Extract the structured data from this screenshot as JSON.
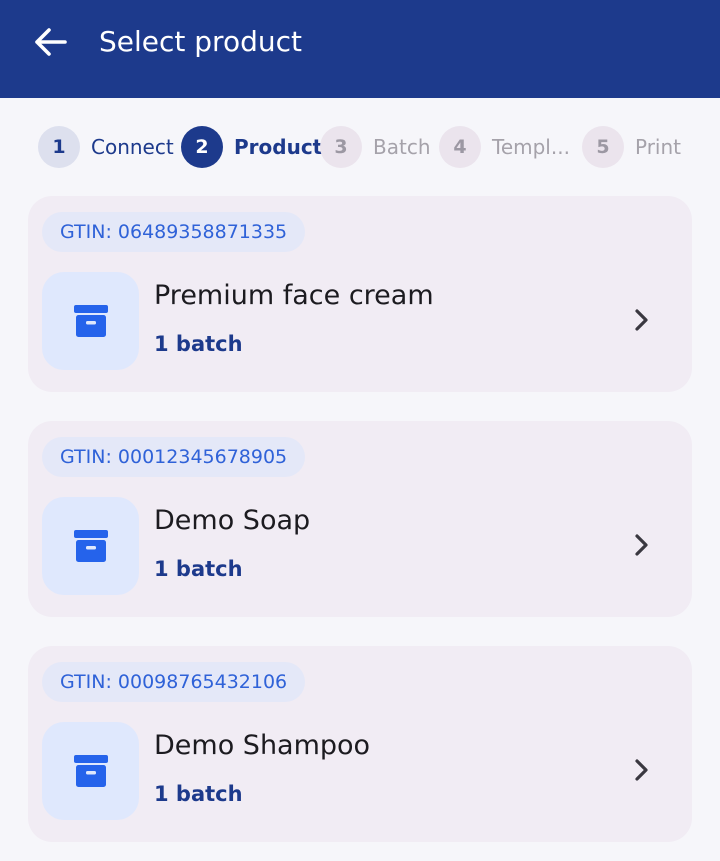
{
  "app_bar": {
    "title": "Select product",
    "back_icon": "arrow-left-icon",
    "background_color": "#1d3a8c"
  },
  "stepper": {
    "steps": [
      {
        "number": "1",
        "label": "Connect",
        "state": "done"
      },
      {
        "number": "2",
        "label": "Product",
        "state": "current"
      },
      {
        "number": "3",
        "label": "Batch",
        "state": "pending"
      },
      {
        "number": "4",
        "label": "Templ...",
        "state": "pending"
      },
      {
        "number": "5",
        "label": "Print",
        "state": "pending"
      }
    ]
  },
  "products": [
    {
      "gtin": "GTIN: 06489358871335",
      "name": "Premium face cream",
      "batches": "1 batch",
      "icon": "archive-box-icon"
    },
    {
      "gtin": "GTIN: 00012345678905",
      "name": "Demo Soap",
      "batches": "1 batch",
      "icon": "archive-box-icon"
    },
    {
      "gtin": "GTIN: 00098765432106",
      "name": "Demo Shampoo",
      "batches": "1 batch",
      "icon": "archive-box-icon"
    }
  ],
  "colors": {
    "accent": "#1d3a8c",
    "chip_text": "#2f62d8",
    "card_background": "#f1ecf4",
    "icon_blue": "#2563eb"
  }
}
